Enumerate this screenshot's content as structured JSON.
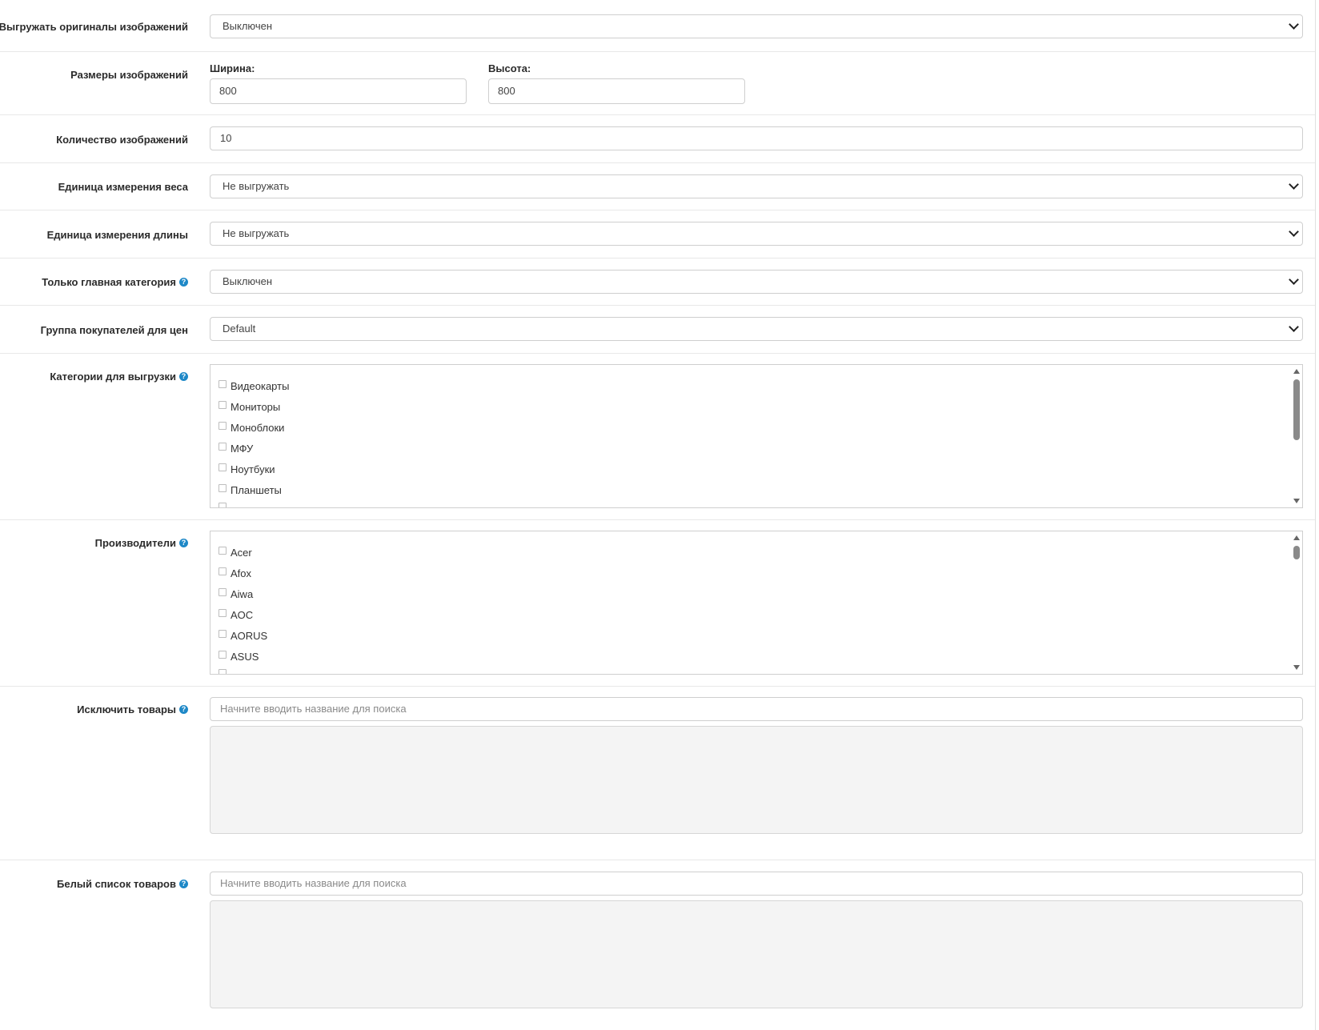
{
  "form": {
    "original_images": {
      "label": "Выгружать оригиналы изображений",
      "value": "Выключен"
    },
    "image_sizes": {
      "label": "Размеры изображений",
      "width_label": "Ширина:",
      "width_value": "800",
      "height_label": "Высота:",
      "height_value": "800"
    },
    "image_count": {
      "label": "Количество изображений",
      "value": "10"
    },
    "weight_unit": {
      "label": "Единица измерения веса",
      "value": "Не выгружать"
    },
    "length_unit": {
      "label": "Единица измерения длины",
      "value": "Не выгружать"
    },
    "main_category": {
      "label": "Только главная категория",
      "value": "Выключен"
    },
    "customer_group": {
      "label": "Группа покупателей для цен",
      "value": "Default"
    },
    "categories": {
      "label": "Категории для выгрузки",
      "items": [
        "Видеокарты",
        "Мониторы",
        "Моноблоки",
        "МФУ",
        "Ноутбуки",
        "Планшеты"
      ]
    },
    "manufacturers": {
      "label": "Производители",
      "items": [
        "Acer",
        "Afox",
        "Aiwa",
        "AOC",
        "AORUS",
        "ASUS"
      ]
    },
    "exclude_products": {
      "label": "Исключить товары",
      "placeholder": "Начните вводить название для поиска"
    },
    "whitelist_products": {
      "label": "Белый список товаров",
      "placeholder": "Начните вводить название для поиска"
    }
  },
  "icons": {
    "help": "help-circle-icon",
    "chevron": "chevron-down-icon"
  },
  "colors": {
    "help_icon": "#1e88c7",
    "textarea_bg": "#f4f4f4"
  }
}
